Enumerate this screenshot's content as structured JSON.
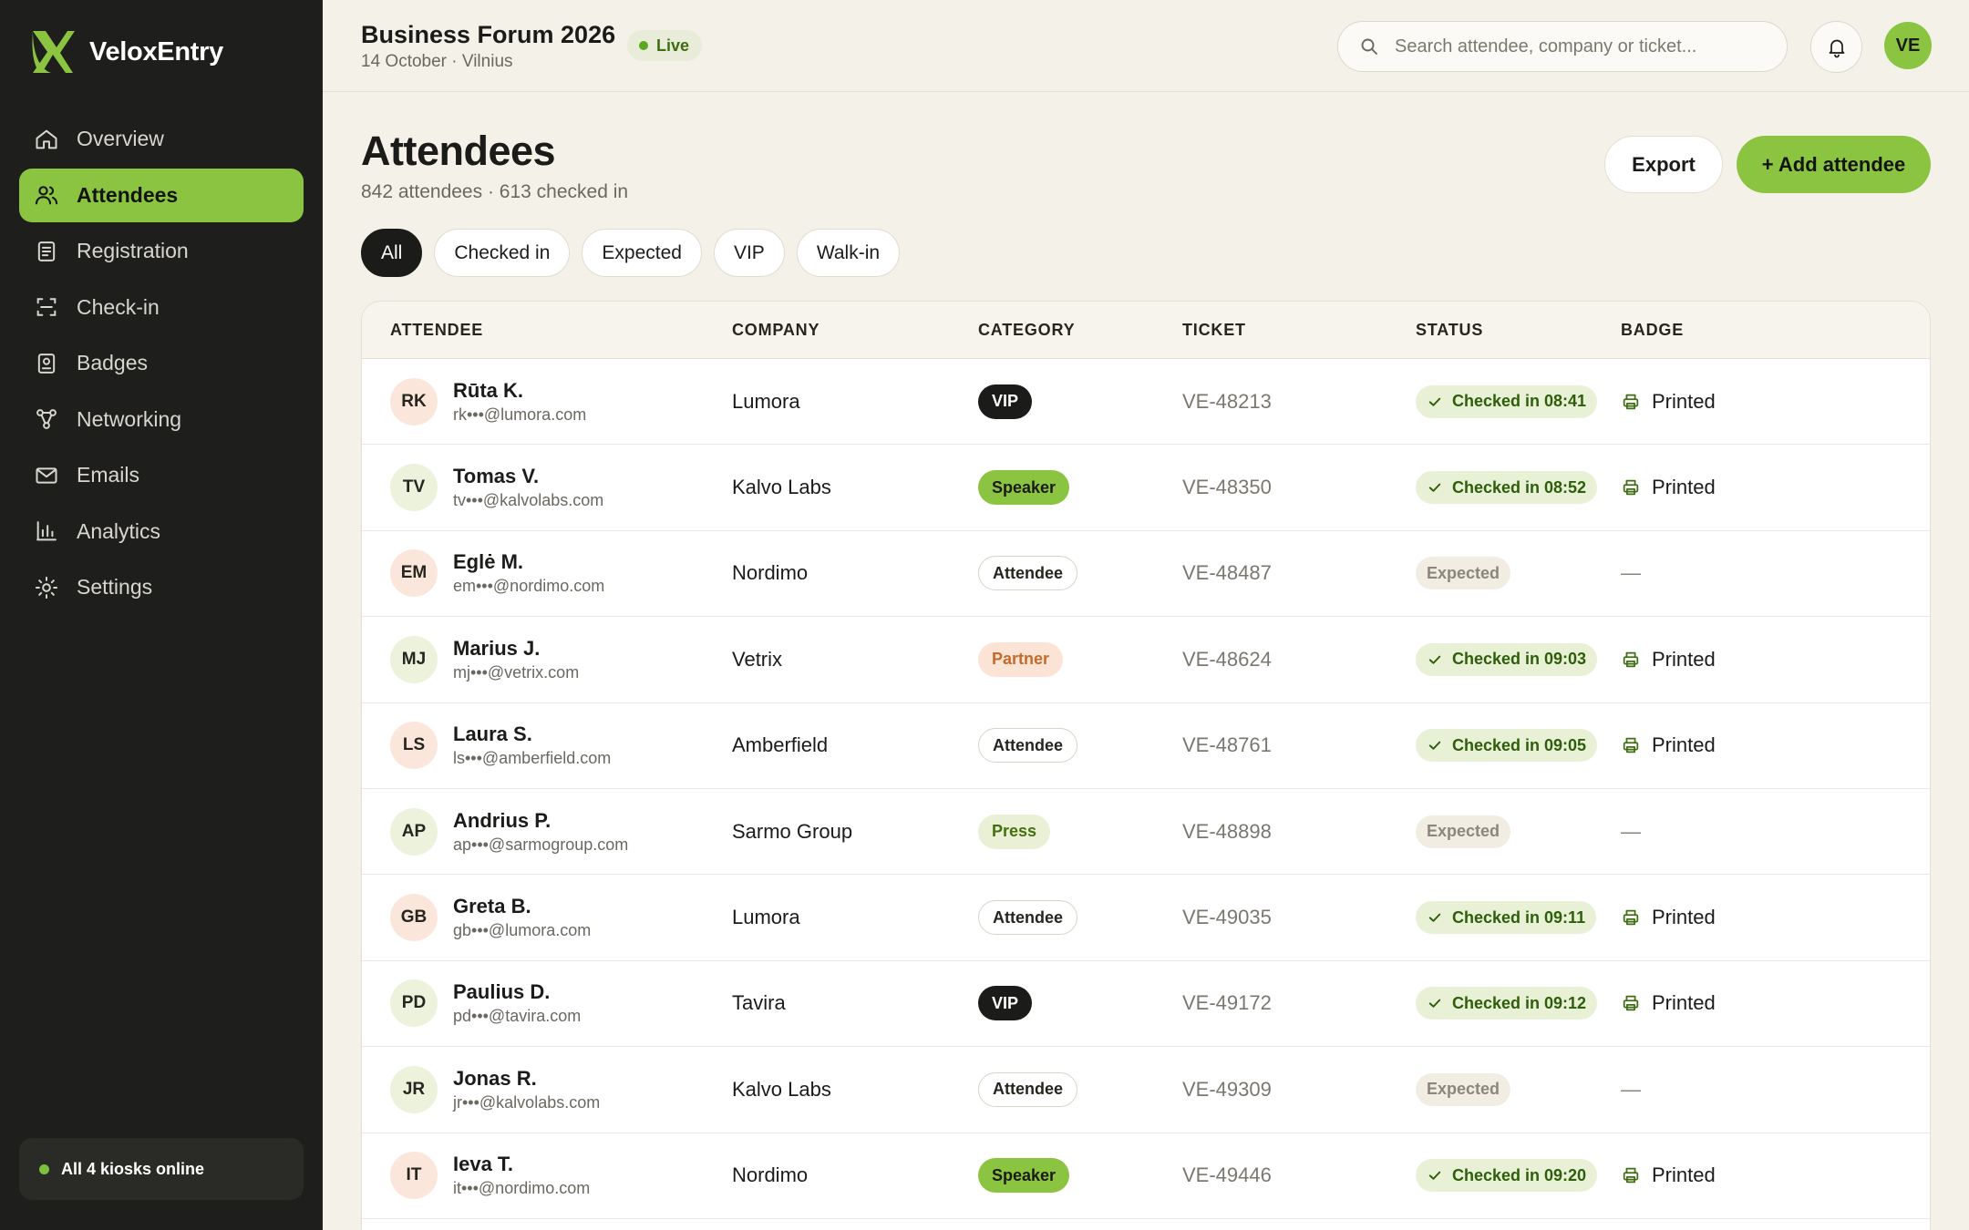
{
  "brand": {
    "name": "VeloxEntry",
    "accent": "#8bc441"
  },
  "nav": [
    {
      "label": "Overview",
      "icon": "home-icon",
      "active": false
    },
    {
      "label": "Attendees",
      "icon": "users-icon",
      "active": true
    },
    {
      "label": "Registration",
      "icon": "clipboard-icon",
      "active": false
    },
    {
      "label": "Check-in",
      "icon": "scan-icon",
      "active": false
    },
    {
      "label": "Badges",
      "icon": "badge-icon",
      "active": false
    },
    {
      "label": "Networking",
      "icon": "network-icon",
      "active": false
    },
    {
      "label": "Emails",
      "icon": "mail-icon",
      "active": false
    },
    {
      "label": "Analytics",
      "icon": "bar-chart-icon",
      "active": false
    },
    {
      "label": "Settings",
      "icon": "gear-icon",
      "active": false
    }
  ],
  "kiosk_status": "All 4 kiosks online",
  "event": {
    "title": "Business Forum 2026",
    "subtitle": "14 October · Vilnius",
    "live_label": "Live"
  },
  "search": {
    "placeholder": "Search attendee, company or ticket..."
  },
  "user": {
    "initials": "VE"
  },
  "page": {
    "title": "Attendees",
    "subtitle": "842 attendees · 613 checked in",
    "export_label": "Export",
    "add_label": "+ Add attendee"
  },
  "filters": [
    {
      "label": "All",
      "active": true
    },
    {
      "label": "Checked in",
      "active": false
    },
    {
      "label": "Expected",
      "active": false
    },
    {
      "label": "VIP",
      "active": false
    },
    {
      "label": "Walk-in",
      "active": false
    }
  ],
  "table": {
    "headers": [
      "ATTENDEE",
      "COMPANY",
      "CATEGORY",
      "TICKET",
      "STATUS",
      "BADGE"
    ],
    "rows": [
      {
        "initials": "RK",
        "name": "Rūta K.",
        "email": "rk•••@lumora.com",
        "company": "Lumora",
        "category": "VIP",
        "ticket": "VE-48213",
        "status": "Checked in 08:41",
        "checked_in": true,
        "badge": "Printed",
        "avatar_tone": "peach"
      },
      {
        "initials": "TV",
        "name": "Tomas V.",
        "email": "tv•••@kalvolabs.com",
        "company": "Kalvo Labs",
        "category": "Speaker",
        "ticket": "VE-48350",
        "status": "Checked in 08:52",
        "checked_in": true,
        "badge": "Printed",
        "avatar_tone": "green"
      },
      {
        "initials": "EM",
        "name": "Eglė M.",
        "email": "em•••@nordimo.com",
        "company": "Nordimo",
        "category": "Attendee",
        "ticket": "VE-48487",
        "status": "Expected",
        "checked_in": false,
        "badge": "—",
        "avatar_tone": "peach"
      },
      {
        "initials": "MJ",
        "name": "Marius J.",
        "email": "mj•••@vetrix.com",
        "company": "Vetrix",
        "category": "Partner",
        "ticket": "VE-48624",
        "status": "Checked in 09:03",
        "checked_in": true,
        "badge": "Printed",
        "avatar_tone": "green"
      },
      {
        "initials": "LS",
        "name": "Laura S.",
        "email": "ls•••@amberfield.com",
        "company": "Amberfield",
        "category": "Attendee",
        "ticket": "VE-48761",
        "status": "Checked in 09:05",
        "checked_in": true,
        "badge": "Printed",
        "avatar_tone": "peach"
      },
      {
        "initials": "AP",
        "name": "Andrius P.",
        "email": "ap•••@sarmogroup.com",
        "company": "Sarmo Group",
        "category": "Press",
        "ticket": "VE-48898",
        "status": "Expected",
        "checked_in": false,
        "badge": "—",
        "avatar_tone": "green"
      },
      {
        "initials": "GB",
        "name": "Greta B.",
        "email": "gb•••@lumora.com",
        "company": "Lumora",
        "category": "Attendee",
        "ticket": "VE-49035",
        "status": "Checked in 09:11",
        "checked_in": true,
        "badge": "Printed",
        "avatar_tone": "peach"
      },
      {
        "initials": "PD",
        "name": "Paulius D.",
        "email": "pd•••@tavira.com",
        "company": "Tavira",
        "category": "VIP",
        "ticket": "VE-49172",
        "status": "Checked in 09:12",
        "checked_in": true,
        "badge": "Printed",
        "avatar_tone": "green"
      },
      {
        "initials": "JR",
        "name": "Jonas R.",
        "email": "jr•••@kalvolabs.com",
        "company": "Kalvo Labs",
        "category": "Attendee",
        "ticket": "VE-49309",
        "status": "Expected",
        "checked_in": false,
        "badge": "—",
        "avatar_tone": "green"
      },
      {
        "initials": "IT",
        "name": "Ieva T.",
        "email": "it•••@nordimo.com",
        "company": "Nordimo",
        "category": "Speaker",
        "ticket": "VE-49446",
        "status": "Checked in 09:20",
        "checked_in": true,
        "badge": "Printed",
        "avatar_tone": "peach"
      }
    ]
  }
}
